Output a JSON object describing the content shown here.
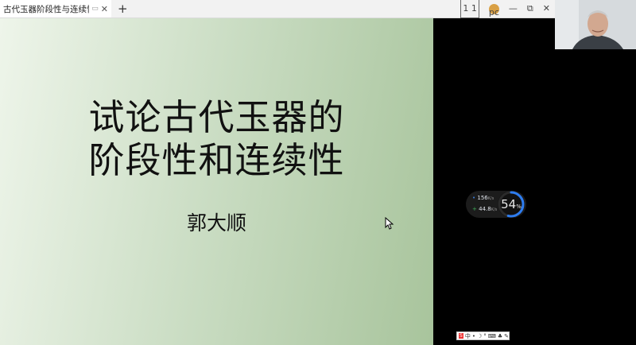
{
  "tab": {
    "title": "古代玉器阶段性与连续性.ppt",
    "icon": "screen-icon",
    "close": "✕"
  },
  "window": {
    "new_tab": "+",
    "layout_badge": "1 1",
    "avatar_initials": "pc",
    "minimize": "—",
    "restore": "⧉",
    "close": "✕"
  },
  "slide": {
    "title_line1": "试论古代玉器的",
    "title_line2": "阶段性和连续性",
    "author": "郭大顺"
  },
  "netmon": {
    "upload_value": "156",
    "upload_unit": "K/s",
    "download_value": "44.8",
    "download_unit": "K/s",
    "percent_value": "54",
    "percent_sign": "%",
    "percent": 54
  },
  "ime": {
    "logo": "S",
    "mode": "中",
    "items": [
      "•",
      "☽",
      "°",
      "⌨",
      "♣",
      "✎"
    ]
  },
  "colors": {
    "slide_gradient_start": "#eef5ea",
    "slide_gradient_end": "#a8c49c",
    "gauge_blue": "#2e7df0",
    "gauge_green": "#36c48f"
  }
}
